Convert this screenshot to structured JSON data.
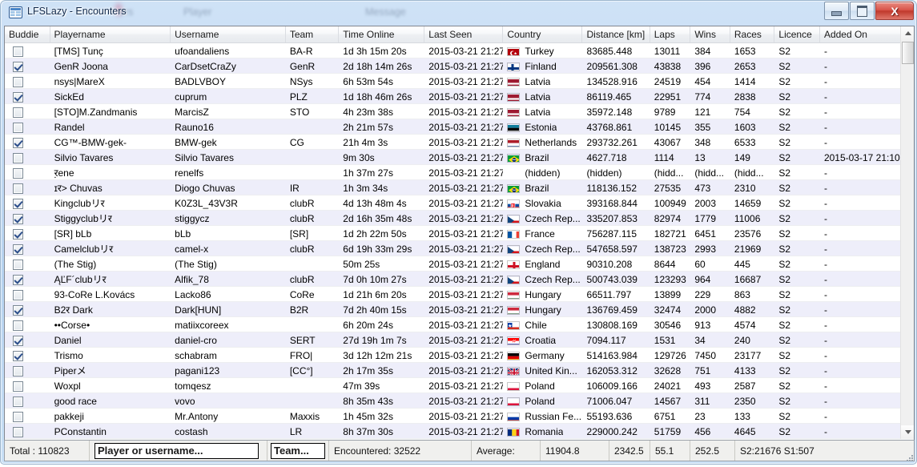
{
  "window": {
    "title": "LFSLazy - Encounters",
    "icon": "app-grid-icon",
    "ghost_texts": [
      "ers",
      "Player",
      "Message"
    ],
    "buttons": {
      "minimize": "Minimize",
      "maximize": "Maximize",
      "close": "X"
    }
  },
  "table": {
    "columns": [
      {
        "key": "buddie",
        "label": "Buddie"
      },
      {
        "key": "player",
        "label": "Playername"
      },
      {
        "key": "user",
        "label": "Username"
      },
      {
        "key": "team",
        "label": "Team"
      },
      {
        "key": "time",
        "label": "Time Online"
      },
      {
        "key": "seen",
        "label": "Last Seen"
      },
      {
        "key": "country",
        "label": "Country"
      },
      {
        "key": "dist",
        "label": "Distance [km]"
      },
      {
        "key": "laps",
        "label": "Laps"
      },
      {
        "key": "wins",
        "label": "Wins"
      },
      {
        "key": "races",
        "label": "Races"
      },
      {
        "key": "lic",
        "label": "Licence"
      },
      {
        "key": "added",
        "label": "Added On"
      }
    ],
    "rows": [
      {
        "buddie": false,
        "player": "[TMS] Tunç",
        "user": "ufoandaliens",
        "team": "BA-R",
        "time": "1d 3h 15m 20s",
        "seen": "2015-03-21 21:27",
        "country": "Turkey",
        "flag": "tr",
        "dist": "83685.448",
        "laps": "13011",
        "wins": "384",
        "races": "1653",
        "lic": "S2",
        "added": "-"
      },
      {
        "buddie": true,
        "player": "GenR Joona",
        "user": "CarDsetCraZy",
        "team": "GenR",
        "time": "2d 18h 14m 26s",
        "seen": "2015-03-21 21:27",
        "country": "Finland",
        "flag": "fi",
        "dist": "209561.308",
        "laps": "43838",
        "wins": "396",
        "races": "2653",
        "lic": "S2",
        "added": "-"
      },
      {
        "buddie": false,
        "player": "nsys|MareX",
        "user": "BADLVBOY",
        "team": "NSys",
        "time": "6h 53m 54s",
        "seen": "2015-03-21 21:27",
        "country": "Latvia",
        "flag": "lv",
        "dist": "134528.916",
        "laps": "24519",
        "wins": "454",
        "races": "1414",
        "lic": "S2",
        "added": "-"
      },
      {
        "buddie": true,
        "player": "SickEd",
        "user": "cuprum",
        "team": "PLZ",
        "time": "1d 18h 46m 26s",
        "seen": "2015-03-21 21:27",
        "country": "Latvia",
        "flag": "lv",
        "dist": "86119.465",
        "laps": "22951",
        "wins": "774",
        "races": "2838",
        "lic": "S2",
        "added": "-"
      },
      {
        "buddie": false,
        "player": "[STO]M.Zandmanis",
        "user": "MarcisZ",
        "team": "STO",
        "time": "4h 23m 38s",
        "seen": "2015-03-21 21:27",
        "country": "Latvia",
        "flag": "lv",
        "dist": "35972.148",
        "laps": "9789",
        "wins": "121",
        "races": "754",
        "lic": "S2",
        "added": "-"
      },
      {
        "buddie": false,
        "player": "Randel",
        "user": "Rauno16",
        "team": "",
        "time": "2h 21m 57s",
        "seen": "2015-03-21 21:27",
        "country": "Estonia",
        "flag": "ee",
        "dist": "43768.861",
        "laps": "10145",
        "wins": "355",
        "races": "1603",
        "lic": "S2",
        "added": "-"
      },
      {
        "buddie": true,
        "player": "CG™-BMW-gek-",
        "user": "BMW-gek",
        "team": "CG",
        "time": "21h 4m 3s",
        "seen": "2015-03-21 21:27",
        "country": "Netherlands",
        "flag": "nl",
        "dist": "293732.261",
        "laps": "43067",
        "wins": "348",
        "races": "6533",
        "lic": "S2",
        "added": "-"
      },
      {
        "buddie": false,
        "player": "Silvio Tavares",
        "user": "Silvio Tavares",
        "team": "",
        "time": "9m 30s",
        "seen": "2015-03-21 21:27",
        "country": "Brazil",
        "flag": "br",
        "dist": "4627.718",
        "laps": "1114",
        "wins": "13",
        "races": "149",
        "lic": "S2",
        "added": "2015-03-17 21:10"
      },
      {
        "buddie": false,
        "player": "र̣ene",
        "user": "renelfs",
        "team": "",
        "time": "1h 37m 27s",
        "seen": "2015-03-21 21:27",
        "country": "(hidden)",
        "flag": "",
        "dist": "(hidden)",
        "laps": "(hidd...",
        "wins": "(hidd...",
        "races": "(hidd...",
        "lic": "S2",
        "added": "-"
      },
      {
        "buddie": false,
        "player": "ɪर> Chuvas",
        "user": "Diogo Chuvas",
        "team": "IR",
        "time": "1h 3m 34s",
        "seen": "2015-03-21 21:27",
        "country": "Brazil",
        "flag": "br",
        "dist": "118136.152",
        "laps": "27535",
        "wins": "473",
        "races": "2310",
        "lic": "S2",
        "added": "-"
      },
      {
        "buddie": true,
        "player": "Kingclubリर",
        "user": "K0Z3L_43V3R",
        "team": "clubR",
        "time": "4d 13h 48m 4s",
        "seen": "2015-03-21 21:27",
        "country": "Slovakia",
        "flag": "sk",
        "dist": "393168.844",
        "laps": "100949",
        "wins": "2003",
        "races": "14659",
        "lic": "S2",
        "added": "-"
      },
      {
        "buddie": true,
        "player": "Stiggyclubリर",
        "user": "stiggycz",
        "team": "clubR",
        "time": "2d 16h 35m 48s",
        "seen": "2015-03-21 21:27",
        "country": "Czech Rep...",
        "flag": "cz",
        "dist": "335207.853",
        "laps": "82974",
        "wins": "1779",
        "races": "11006",
        "lic": "S2",
        "added": "-"
      },
      {
        "buddie": true,
        "player": "[SR] bLb",
        "user": "bLb",
        "team": "[SR]",
        "time": "1d 2h 22m 50s",
        "seen": "2015-03-21 21:27",
        "country": "France",
        "flag": "fr",
        "dist": "756287.115",
        "laps": "182721",
        "wins": "6451",
        "races": "23576",
        "lic": "S2",
        "added": "-"
      },
      {
        "buddie": true,
        "player": "Camelclubリर",
        "user": "camel-x",
        "team": "clubR",
        "time": "6d 19h 33m 29s",
        "seen": "2015-03-21 21:27",
        "country": "Czech Rep...",
        "flag": "cz",
        "dist": "547658.597",
        "laps": "138723",
        "wins": "2993",
        "races": "21969",
        "lic": "S2",
        "added": "-"
      },
      {
        "buddie": false,
        "player": "(The Stig)",
        "user": "(The Stig)",
        "team": "",
        "time": "50m 25s",
        "seen": "2015-03-21 21:27",
        "country": "England",
        "flag": "en",
        "dist": "90310.208",
        "laps": "8644",
        "wins": "60",
        "races": "445",
        "lic": "S2",
        "added": "-"
      },
      {
        "buddie": true,
        "player": "ĄĽF´clubリर",
        "user": "Alfik_78",
        "team": "clubR",
        "time": "7d 0h 10m 27s",
        "seen": "2015-03-21 21:27",
        "country": "Czech Rep...",
        "flag": "cz",
        "dist": "500743.039",
        "laps": "123293",
        "wins": "964",
        "races": "16687",
        "lic": "S2",
        "added": "-"
      },
      {
        "buddie": false,
        "player": "93-CoRe L.Kovács",
        "user": "Lacko86",
        "team": "CoRe",
        "time": "1d 21h 6m 20s",
        "seen": "2015-03-21 21:27",
        "country": "Hungary",
        "flag": "hu",
        "dist": "66511.797",
        "laps": "13899",
        "wins": "229",
        "races": "863",
        "lic": "S2",
        "added": "-"
      },
      {
        "buddie": true,
        "player": "B2र Dark",
        "user": "Dark[HUN]",
        "team": "B2R",
        "time": "7d 2h 40m 15s",
        "seen": "2015-03-21 21:27",
        "country": "Hungary",
        "flag": "hu",
        "dist": "136769.459",
        "laps": "32474",
        "wins": "2000",
        "races": "4882",
        "lic": "S2",
        "added": "-"
      },
      {
        "buddie": false,
        "player": "••Corse•",
        "user": "matiixcoreex",
        "team": "",
        "time": "6h 20m 24s",
        "seen": "2015-03-21 21:27",
        "country": "Chile",
        "flag": "cl",
        "dist": "130808.169",
        "laps": "30546",
        "wins": "913",
        "races": "4574",
        "lic": "S2",
        "added": "-"
      },
      {
        "buddie": true,
        "player": "Daniel",
        "user": "daniel-cro",
        "team": "SERT",
        "time": "27d 19h 1m 7s",
        "seen": "2015-03-21 21:27",
        "country": "Croatia",
        "flag": "hr",
        "dist": "7094.117",
        "laps": "1531",
        "wins": "34",
        "races": "240",
        "lic": "S2",
        "added": "-"
      },
      {
        "buddie": true,
        "player": "Trismo",
        "user": "schabram",
        "team": "FRO|",
        "time": "3d 12h 12m 21s",
        "seen": "2015-03-21 21:27",
        "country": "Germany",
        "flag": "de",
        "dist": "514163.984",
        "laps": "129726",
        "wins": "7450",
        "races": "23177",
        "lic": "S2",
        "added": "-"
      },
      {
        "buddie": false,
        "player": "Piperメ",
        "user": "pagani123",
        "team": "[CC°]",
        "time": "2h 17m 35s",
        "seen": "2015-03-21 21:27",
        "country": "United Kin...",
        "flag": "gb",
        "dist": "162053.312",
        "laps": "32628",
        "wins": "751",
        "races": "4133",
        "lic": "S2",
        "added": "-"
      },
      {
        "buddie": false,
        "player": "Woxpl",
        "user": "tomqesz",
        "team": "",
        "time": "47m 39s",
        "seen": "2015-03-21 21:27",
        "country": "Poland",
        "flag": "pl",
        "dist": "106009.166",
        "laps": "24021",
        "wins": "493",
        "races": "2587",
        "lic": "S2",
        "added": "-"
      },
      {
        "buddie": false,
        "player": "good race",
        "user": "vovo",
        "team": "",
        "time": "8h 35m 43s",
        "seen": "2015-03-21 21:27",
        "country": "Poland",
        "flag": "pl",
        "dist": "71006.047",
        "laps": "14567",
        "wins": "311",
        "races": "2350",
        "lic": "S2",
        "added": "-"
      },
      {
        "buddie": false,
        "player": "pakkeji",
        "user": "Mr.Antony",
        "team": "Maxxis",
        "time": "1h 45m 32s",
        "seen": "2015-03-21 21:27",
        "country": "Russian Fe...",
        "flag": "ru",
        "dist": "55193.636",
        "laps": "6751",
        "wins": "23",
        "races": "133",
        "lic": "S2",
        "added": "-"
      },
      {
        "buddie": false,
        "player": "PConstantin",
        "user": "costash",
        "team": "LR",
        "time": "8h 37m 30s",
        "seen": "2015-03-21 21:27",
        "country": "Romania",
        "flag": "ro",
        "dist": "229000.242",
        "laps": "51759",
        "wins": "456",
        "races": "4645",
        "lic": "S2",
        "added": "-"
      }
    ]
  },
  "statusbar": {
    "total": "Total : 110823",
    "search_value": "Player or username...",
    "team_value": "Team...",
    "encountered": "Encountered: 32522",
    "average_label": "Average:",
    "avg_distance": "11904.8",
    "avg_laps": "2342.5",
    "avg_wins": "55.1",
    "avg_races": "252.5",
    "licence_summary": "S2:21676 S1:507"
  }
}
